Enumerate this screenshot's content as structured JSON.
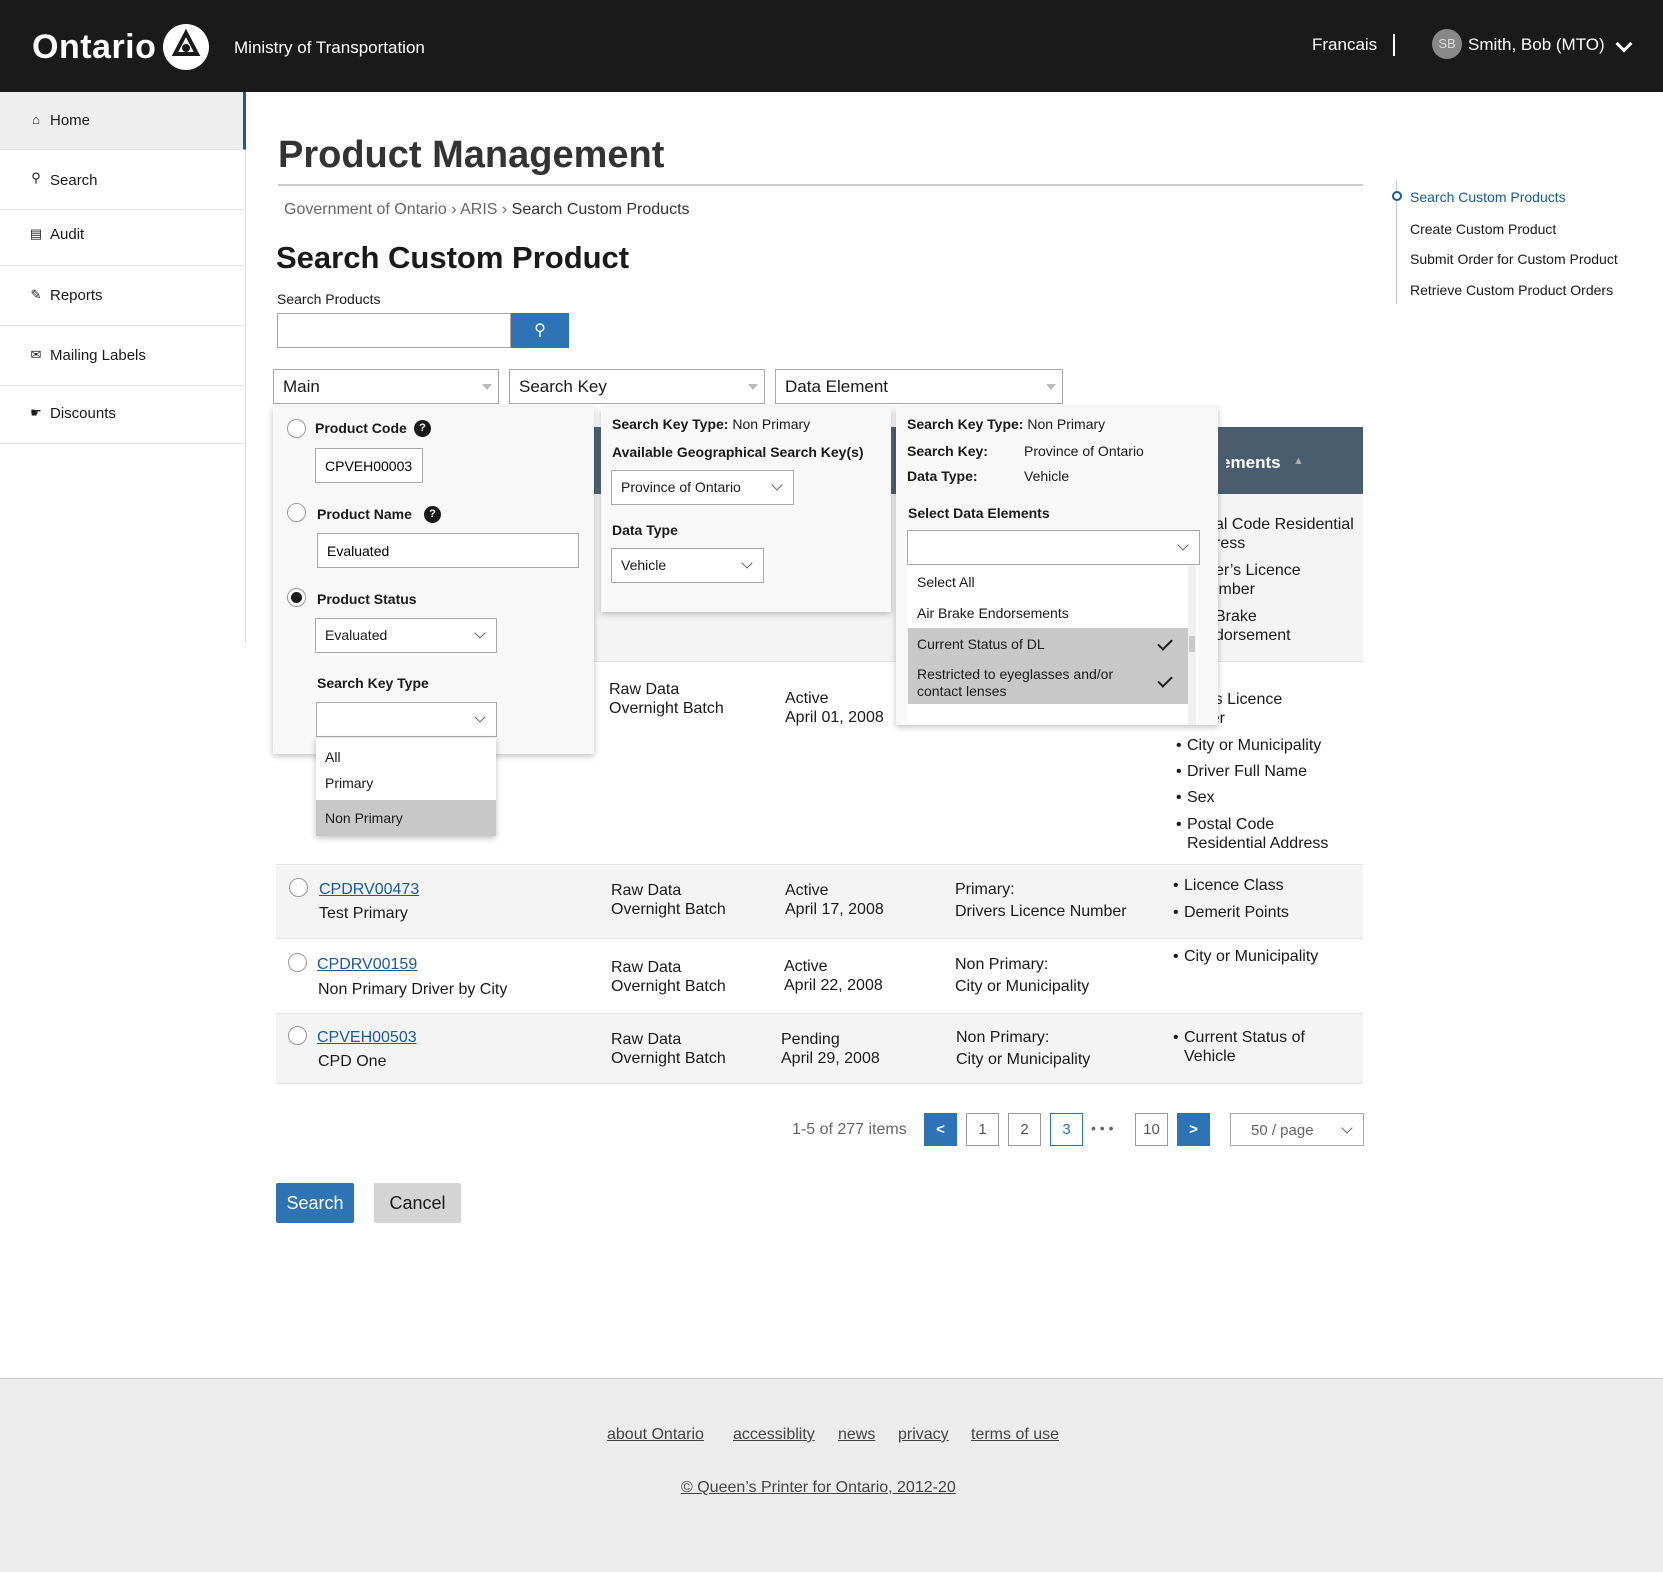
{
  "header": {
    "logo_text": "Ontario",
    "ministry": "Ministry of Transportation",
    "language": "Francais",
    "avatar_initials": "SB",
    "user_name": "Smith, Bob (MTO)"
  },
  "sidebar": {
    "items": [
      {
        "label": "Home",
        "icon": "home-icon"
      },
      {
        "label": "Search",
        "icon": "search-icon"
      },
      {
        "label": "Audit",
        "icon": "audit-icon"
      },
      {
        "label": "Reports",
        "icon": "clipboard-icon"
      },
      {
        "label": "Mailing Labels",
        "icon": "mail-icon"
      },
      {
        "label": "Discounts",
        "icon": "discount-icon"
      }
    ]
  },
  "page": {
    "title": "Product Management",
    "subtitle": "Search Custom Product"
  },
  "breadcrumb": [
    "Government of Ontario",
    "ARIS",
    "Search Custom Products"
  ],
  "search": {
    "label": "Search Products",
    "value": ""
  },
  "filters": {
    "main": "Main",
    "search_key": "Search Key",
    "data_element": "Data Element"
  },
  "main_panel": {
    "product_code_label": "Product Code",
    "product_code_value": "CPVEH00003",
    "product_name_label": "Product Name",
    "product_name_value": "Evaluated",
    "product_status_label": "Product Status",
    "product_status_value": "Evaluated",
    "search_key_type_label": "Search Key Type",
    "search_key_type_value": "",
    "options": [
      "All",
      "Primary",
      "Non Primary"
    ],
    "selected_option": "Non Primary"
  },
  "search_key_panel": {
    "type_label": "Search Key Type:",
    "type_value": "Non Primary",
    "geo_label": "Available Geographical Search Key(s)",
    "geo_value": "Province of Ontario",
    "data_type_label": "Data Type",
    "data_type_value": "Vehicle"
  },
  "data_element_panel": {
    "type_label": "Search Key Type:",
    "type_value": "Non Primary",
    "key_label": "Search Key:",
    "key_value": "Province of Ontario",
    "dtype_label": "Data Type:",
    "dtype_value": "Vehicle",
    "select_label": "Select Data Elements",
    "select_value": "",
    "options": [
      {
        "label": "Select All",
        "checked": false
      },
      {
        "label": "Air Brake Endorsements",
        "checked": false
      },
      {
        "label": "Current Status of DL",
        "checked": true
      },
      {
        "label": "Restricted to eyeglasses and/or contact lenses",
        "checked": true
      }
    ]
  },
  "table": {
    "header_elements": "Elements",
    "partial_row1": [
      "al Code Residential",
      "ress",
      "er’s Licence",
      "imber",
      "Brake",
      "dorsement"
    ],
    "row2": {
      "type1": "Raw Data",
      "type2": "Overnight Batch",
      "status": "Active",
      "date": "April 01, 2008",
      "elements_partial": [
        "iver’s Licence",
        "imber"
      ],
      "elements": [
        "City or Municipality",
        "Driver Full Name",
        "Sex",
        "Postal Code Residential Address"
      ]
    },
    "rows": [
      {
        "code": "CPDRV00473",
        "name": "Test Primary",
        "type1": "Raw Data",
        "type2": "Overnight Batch",
        "status": "Active",
        "date": "April 17, 2008",
        "key_type": "Primary:",
        "key": "Drivers Licence Number",
        "elements": [
          "Licence Class",
          "Demerit Points"
        ]
      },
      {
        "code": "CPDRV00159",
        "name": "Non Primary Driver by City",
        "type1": "Raw Data",
        "type2": "Overnight Batch",
        "status": "Active",
        "date": "April 22, 2008",
        "key_type": "Non Primary:",
        "key": "City or Municipality",
        "elements": [
          "City or Municipality"
        ]
      },
      {
        "code": "CPVEH00503",
        "name": "CPD One",
        "type1": "Raw Data",
        "type2": "Overnight Batch",
        "status": "Pending",
        "date": "April 29, 2008",
        "key_type": "Non Primary:",
        "key": "City or Municipality",
        "elements": [
          "Current Status of Vehicle"
        ]
      }
    ]
  },
  "pagination": {
    "summary": "1-5 of 277 items",
    "prev": "<",
    "next": ">",
    "pages": [
      "1",
      "2",
      "3",
      "10"
    ],
    "current": "3",
    "ellipsis": "• • •",
    "page_size": "50 / page"
  },
  "actions": {
    "search": "Search",
    "cancel": "Cancel"
  },
  "toc": [
    "Search Custom Products",
    "Create Custom Product",
    "Submit Order for Custom Product",
    "Retrieve Custom Product Orders"
  ],
  "footer": {
    "links": [
      "about Ontario",
      "accessiblity",
      "news",
      "privacy",
      "terms of use"
    ],
    "copyright": "© Queen’s Printer for Ontario, 2012-20"
  },
  "colors": {
    "header_bg": "#1a1a1a",
    "accent": "#2e74b5",
    "table_header": "#4a5d6e",
    "footer_bg": "#ececec"
  }
}
